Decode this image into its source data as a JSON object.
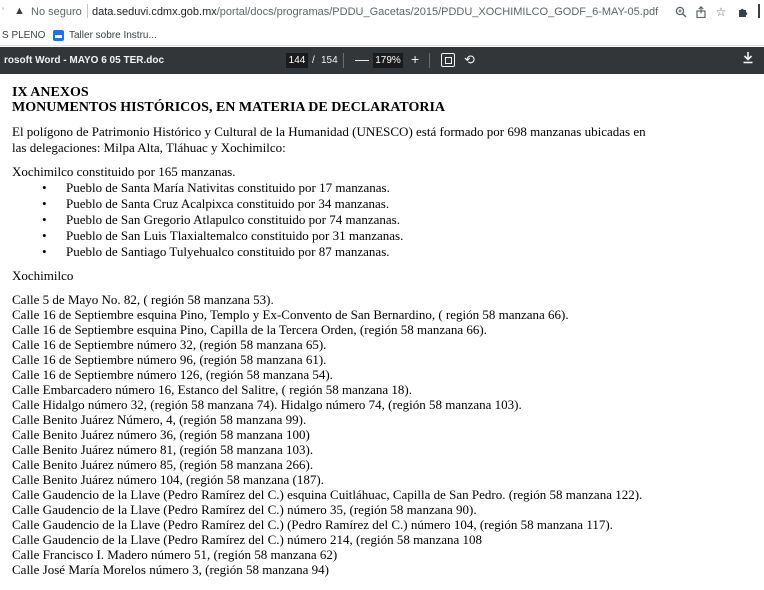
{
  "browser": {
    "lead_char": "'",
    "not_secure": "No seguro",
    "url_host": "data.seduvi.cdmx.gob.mx",
    "url_path": "/portal/docs/programas/PDDU_Gacetas/2015/PDDU_XOCHIMILCO_GODF_6-MAY-05.pdf",
    "icons": [
      "zoom-icon",
      "share-icon",
      "star-icon",
      "extensions-icon"
    ]
  },
  "bookmarks": [
    {
      "label": "S PLENO"
    },
    {
      "label": "Taller sobre Instru..."
    }
  ],
  "pdf_toolbar": {
    "doc_title": "rosoft Word - MAYO 6 05 TER.doc",
    "current_page": "144",
    "slash": "/",
    "total_pages": "154",
    "zoom_minus": "—",
    "zoom": "179%",
    "zoom_plus": "+"
  },
  "document": {
    "heading1": "IX ANEXOS",
    "heading2": "MONUMENTOS HISTÓRICOS, EN MATERIA DE  DECLARATORIA",
    "para1_line1": "El polígono de Patrimonio Histórico y Cultural de la Humanidad (UNESCO) está formado por 698 manzanas ubicadas en",
    "para1_line2": "las delegaciones: Milpa Alta, Tláhuac y Xochimilco:",
    "xochi_intro": "Xochimilco constituido por 165 manzanas.",
    "bullets": [
      "Pueblo de Santa María Nativitas constituido por 17 manzanas.",
      "Pueblo de Santa Cruz Acalpixca constituido por 34 manzanas.",
      "Pueblo de San Gregorio Atlapulco constituido por 74 manzanas.",
      "Pueblo de San Luis Tlaxialtemalco constituido por 31 manzanas.",
      "Pueblo de Santiago Tulyehualco constituido por 87 manzanas."
    ],
    "section_label": "Xochimilco",
    "entries": [
      "Calle 5 de Mayo No. 82, ( región 58 manzana 53).",
      "Calle 16 de Septiembre esquina Pino, Templo y Ex-Convento de San Bernardino, ( región 58 manzana 66).",
      "Calle 16 de Septiembre esquina Pino, Capilla de la Tercera Orden, (región 58 manzana 66).",
      "Calle 16 de Septiembre número 32, (región 58 manzana 65).",
      "Calle 16 de Septiembre número 96, (región 58 manzana 61).",
      "Calle 16 de Septiembre número 126, (región 58 manzana 54).",
      "Calle Embarcadero número 16, Estanco del Salitre, ( región 58 manzana 18).",
      "Calle Hidalgo número 32, (región 58 manzana 74). Hidalgo número 74, (región 58 manzana 103).",
      "Calle Benito Juárez Número, 4, (región 58 manzana 99).",
      "Calle Benito Juárez número 36, (región 58 manzana 100)",
      "Calle Benito Juárez número 81, (región 58 manzana 103).",
      "Calle Benito Juárez número 85, (región 58 manzana 266).",
      "Calle Benito Juárez número 104, (región 58 manzana (187).",
      "Calle Gaudencio de la Llave (Pedro Ramírez del C.) esquina Cuitláhuac, Capilla de San Pedro. (región 58 manzana 122).",
      "Calle Gaudencio de la Llave (Pedro Ramírez del C.) número 35, (región 58 manzana 90).",
      "Calle Gaudencio de la Llave (Pedro Ramírez del C.) (Pedro Ramírez del C.) número 104, (región 58 manzana 117).",
      "Calle Gaudencio de la Llave (Pedro Ramírez del C.) número 214, (región 58 manzana 108",
      "Calle Francisco I. Madero número 51, (región 58 manzana 62)",
      "Calle José María Morelos número 3, (región 58 manzana 94)"
    ]
  }
}
